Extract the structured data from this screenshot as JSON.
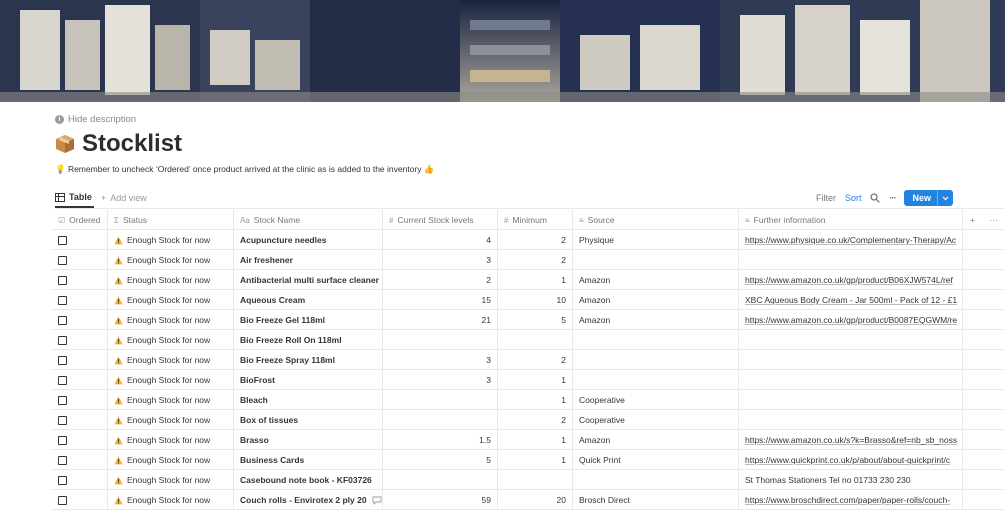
{
  "header": {
    "hide_description": "Hide description",
    "title": "Stocklist",
    "description": "💡 Remember to uncheck ‘Ordered’ once product arrived at the clinic as is added to the inventory 👍"
  },
  "viewbar": {
    "tab_table": "Table",
    "add_view": "Add view",
    "filter": "Filter",
    "sort": "Sort",
    "new": "New"
  },
  "columns": {
    "ordered": "Ordered",
    "status": "Status",
    "name": "Stock Name",
    "current": "Current Stock levels",
    "minimum": "Minimum",
    "source": "Source",
    "info": "Further information"
  },
  "rows": [
    {
      "status": "Enough Stock for now",
      "name": "Acupuncture needles",
      "current": "4",
      "minimum": "2",
      "source": "Physique",
      "info": "https://www.physique.co.uk/Complementary-Therapy/Ac"
    },
    {
      "status": "Enough Stock for now",
      "name": "Air freshener",
      "current": "3",
      "minimum": "2",
      "source": "",
      "info": ""
    },
    {
      "status": "Enough Stock for now",
      "name": "Antibacterial multi surface cleaner",
      "current": "2",
      "minimum": "1",
      "source": "Amazon",
      "info": "https://www.amazon.co.uk/gp/product/B06XJW574L/ref"
    },
    {
      "status": "Enough Stock for now",
      "name": "Aqueous Cream",
      "current": "15",
      "minimum": "10",
      "source": "Amazon",
      "info": "XBC Aqueous Body Cream - Jar 500ml - Pack of 12 - £1"
    },
    {
      "status": "Enough Stock for now",
      "name": "Bio Freeze Gel 118ml",
      "current": "21",
      "minimum": "5",
      "source": "Amazon",
      "info": "https://www.amazon.co.uk/gp/product/B0087EQGWM/re"
    },
    {
      "status": "Enough Stock for now",
      "name": "Bio Freeze Roll On 118ml",
      "current": "",
      "minimum": "",
      "source": "",
      "info": ""
    },
    {
      "status": "Enough Stock for now",
      "name": "Bio Freeze Spray 118ml",
      "current": "3",
      "minimum": "2",
      "source": "",
      "info": ""
    },
    {
      "status": "Enough Stock for now",
      "name": "BioFrost",
      "current": "3",
      "minimum": "1",
      "source": "",
      "info": ""
    },
    {
      "status": "Enough Stock for now",
      "name": "Bleach",
      "current": "",
      "minimum": "1",
      "source": "Cooperative",
      "info": ""
    },
    {
      "status": "Enough Stock for now",
      "name": "Box of tissues",
      "current": "",
      "minimum": "2",
      "source": "Cooperative",
      "info": ""
    },
    {
      "status": "Enough Stock for now",
      "name": "Brasso",
      "current": "1.5",
      "minimum": "1",
      "source": "Amazon",
      "info": "https://www.amazon.co.uk/s?k=Brasso&ref=nb_sb_noss"
    },
    {
      "status": "Enough Stock for now",
      "name": "Business Cards",
      "current": "5",
      "minimum": "1",
      "source": "Quick Print",
      "info": "https://www.quickprint.co.uk/p/about/about-quickprint/c"
    },
    {
      "status": "Enough Stock for now",
      "name": "Casebound note book - KF03726",
      "current": "",
      "minimum": "",
      "source": "",
      "info": "St Thomas Stationers Tel no 01733 230 230"
    },
    {
      "status": "Enough Stock for now",
      "name": "Couch rolls - Envirotex 2 ply 20",
      "current": "59",
      "minimum": "20",
      "source": "Brosch Direct",
      "info": "https://www.broschdirect.com/paper/paper-rolls/couch-"
    }
  ],
  "icons": {
    "title": "package-icon",
    "status": "warning-icon"
  }
}
